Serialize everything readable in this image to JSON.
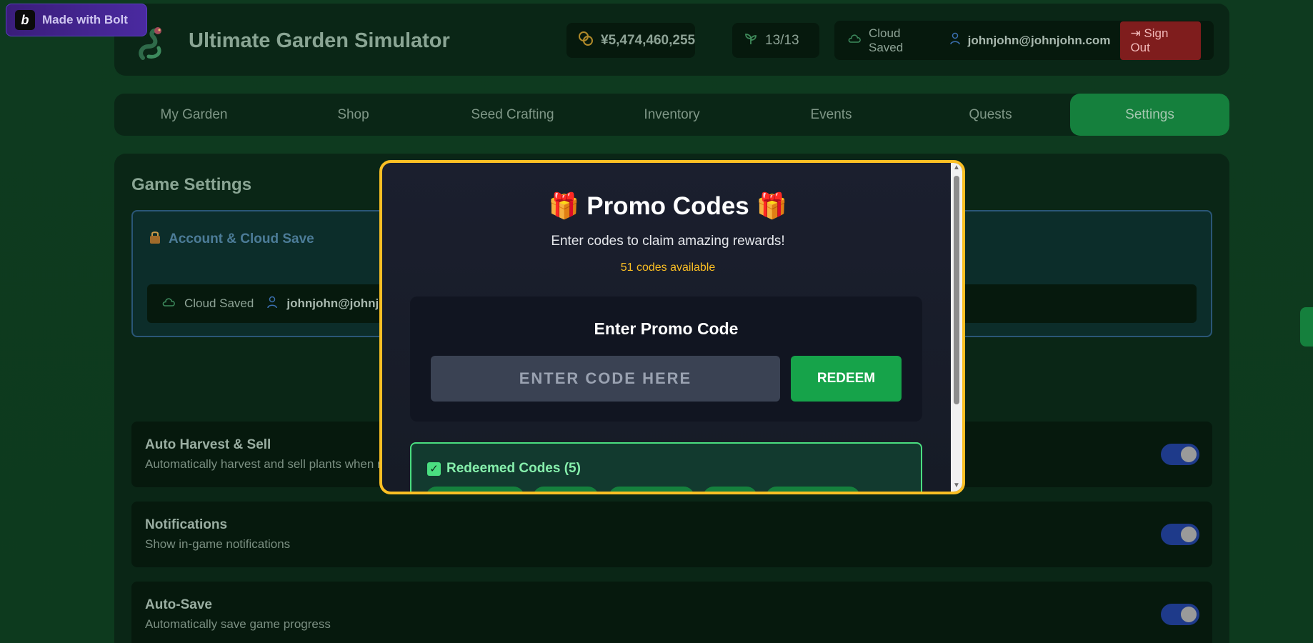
{
  "bolt_badge": {
    "label": "Made with Bolt",
    "letter": "b"
  },
  "header": {
    "title": "Ultimate Garden Simulator",
    "money": "¥5,474,460,255",
    "plants": "13/13",
    "cloud_status": "Cloud Saved",
    "email": "johnjohn@johnjohn.com",
    "sign_out": "Sign Out"
  },
  "nav": {
    "tabs": [
      {
        "label": "My Garden"
      },
      {
        "label": "Shop"
      },
      {
        "label": "Seed Crafting"
      },
      {
        "label": "Inventory"
      },
      {
        "label": "Events"
      },
      {
        "label": "Quests"
      },
      {
        "label": "Settings"
      }
    ],
    "active": "Settings"
  },
  "settings": {
    "title": "Game Settings",
    "account_heading": "Account & Cloud Save",
    "cloud_status": "Cloud Saved",
    "email_partial": "johnjohn@johnjol",
    "rows": [
      {
        "name": "Auto Harvest & Sell",
        "desc": "Automatically harvest and sell plants when r"
      },
      {
        "name": "Notifications",
        "desc": "Show in-game notifications"
      },
      {
        "name": "Auto-Save",
        "desc": "Automatically save game progress"
      }
    ]
  },
  "modal": {
    "title": "Promo Codes",
    "subtitle": "Enter codes to claim amazing rewards!",
    "count": "51 codes available",
    "box_title": "Enter Promo Code",
    "input_placeholder": "ENTER CODE HERE",
    "redeem_label": "REDEEM",
    "redeemed_title": "Redeemed Codes (5)"
  },
  "colors": {
    "accent_green": "#16a34a",
    "modal_border": "#fbbf24",
    "sign_out_bg": "#7f1d1d"
  }
}
